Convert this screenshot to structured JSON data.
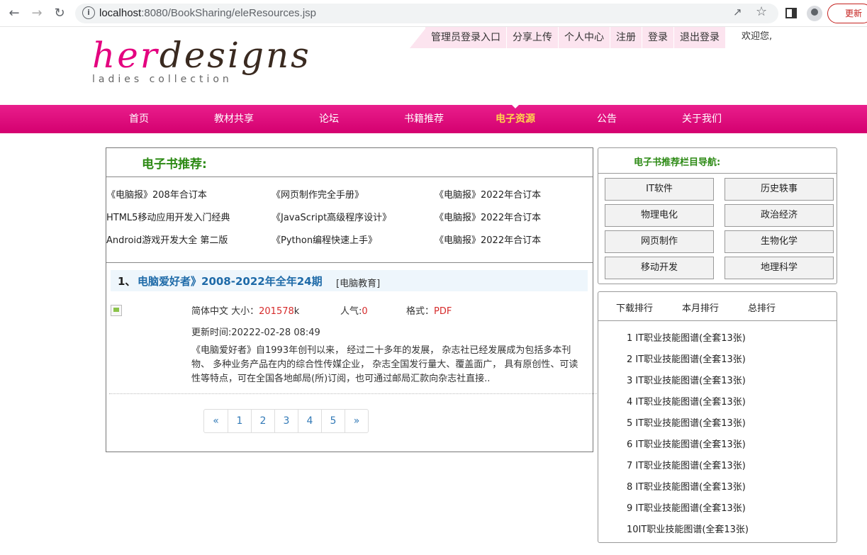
{
  "browser": {
    "url_host": "localhost",
    "url_path": ":8080/BookSharing/eleResources.jsp",
    "update_label": "更新"
  },
  "header": {
    "top_links": [
      "管理员登录入口",
      "分享上传",
      "个人中心",
      "注册",
      "登录",
      "退出登录"
    ],
    "welcome": "欢迎您,",
    "logo_her": "her",
    "logo_designs": "designs",
    "logo_sub": "ladies collection"
  },
  "nav": {
    "items": [
      "首页",
      "教材共享",
      "论坛",
      "书籍推荐",
      "电子资源",
      "公告",
      "关于我们"
    ],
    "active_index": 4
  },
  "recommend": {
    "title": "电子书推荐:",
    "items": [
      "《电脑报》208年合订本",
      "《网页制作完全手册》",
      "《电脑报》2022年合订本",
      "HTML5移动应用开发入门经典",
      "《JavaScript高级程序设计》",
      "《电脑报》2022年合订本",
      "Android游戏开发大全 第二版",
      "《Python编程快速上手》",
      "《电脑报》2022年合订本"
    ]
  },
  "book": {
    "num": "1、",
    "title": "电脑爱好者》2008-2022年全年24期",
    "category": "[电脑教育]",
    "lang_size_label": "简体中文 大小：",
    "size_value": "201578",
    "size_unit": "k",
    "popularity_label": "人气:",
    "popularity_value": "0",
    "format_label": "格式：",
    "format_value": "PDF",
    "updated": "更新时间:20222-02-28 08:49",
    "description": "《电脑爱好者》自1993年创刊以来， 经过二十多年的发展， 杂志社已经发展成为包括多本刊物、 多种业务产品在内的综合性传媒企业， 杂志全国发行量大、覆盖面广， 具有原创性、可读性等特点，可在全国各地邮局(所)订阅，也可通过邮局汇款向杂志社直接.."
  },
  "pager": [
    "«",
    "1",
    "2",
    "3",
    "4",
    "5",
    "»"
  ],
  "category_nav": {
    "title": "电子书推荐栏目导航:",
    "buttons": [
      "IT软件",
      "历史轶事",
      "物理电化",
      "政治经济",
      "网页制作",
      "生物化学",
      "移动开发",
      "地理科学"
    ]
  },
  "ranking": {
    "tabs": [
      "下载排行",
      "本月排行",
      "总排行"
    ],
    "items": [
      "1 IT职业技能图谱(全套13张)",
      "2 IT职业技能图谱(全套13张)",
      "3 IT职业技能图谱(全套13张)",
      "4 IT职业技能图谱(全套13张)",
      "5 IT职业技能图谱(全套13张)",
      "6 IT职业技能图谱(全套13张)",
      "7 IT职业技能图谱(全套13张)",
      "8 IT职业技能图谱(全套13张)",
      "9 IT职业技能图谱(全套13张)",
      "10IT职业技能图谱(全套13张)"
    ]
  }
}
